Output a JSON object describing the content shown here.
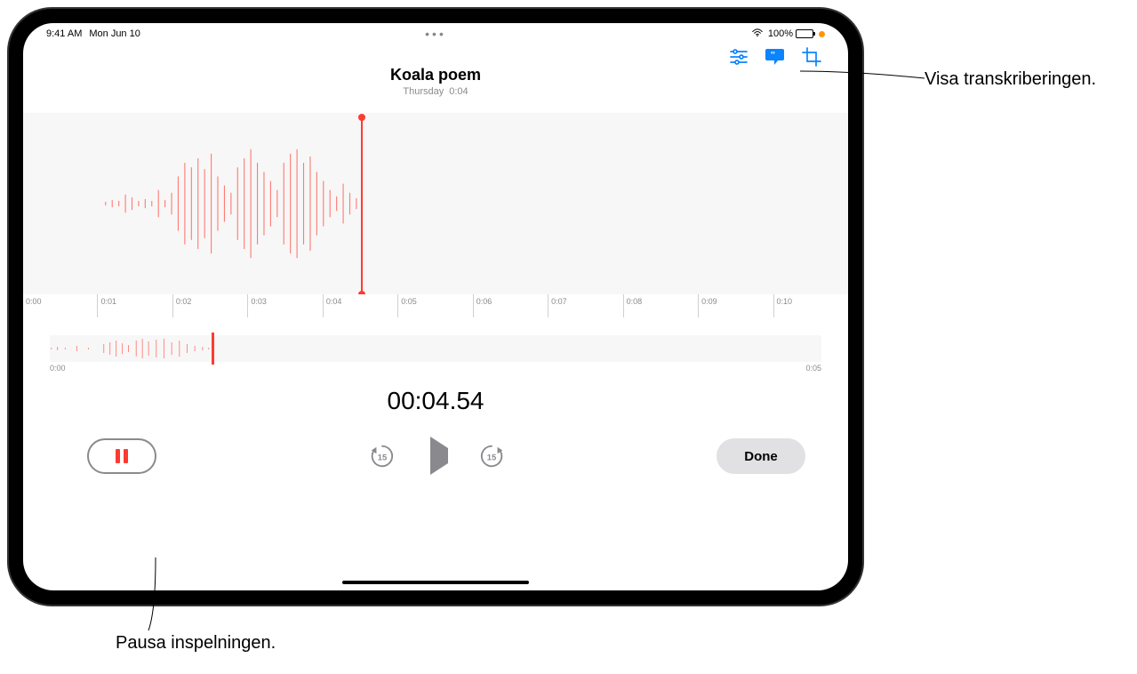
{
  "status": {
    "time": "9:41 AM",
    "date": "Mon Jun 10",
    "battery_pct": "100%"
  },
  "recording": {
    "title": "Koala poem",
    "day": "Thursday",
    "duration": "0:04",
    "timer": "00:04.54",
    "ruler_ticks": [
      "0:00",
      "0:01",
      "0:02",
      "0:03",
      "0:04",
      "0:05",
      "0:06",
      "0:07",
      "0:08",
      "0:09",
      "0:10"
    ],
    "overview_start": "0:00",
    "overview_end": "0:05"
  },
  "controls": {
    "done_label": "Done",
    "skip_back_seconds": "15",
    "skip_fwd_seconds": "15"
  },
  "callouts": {
    "transcribe": "Visa transkriberingen.",
    "pause": "Pausa inspelningen."
  }
}
